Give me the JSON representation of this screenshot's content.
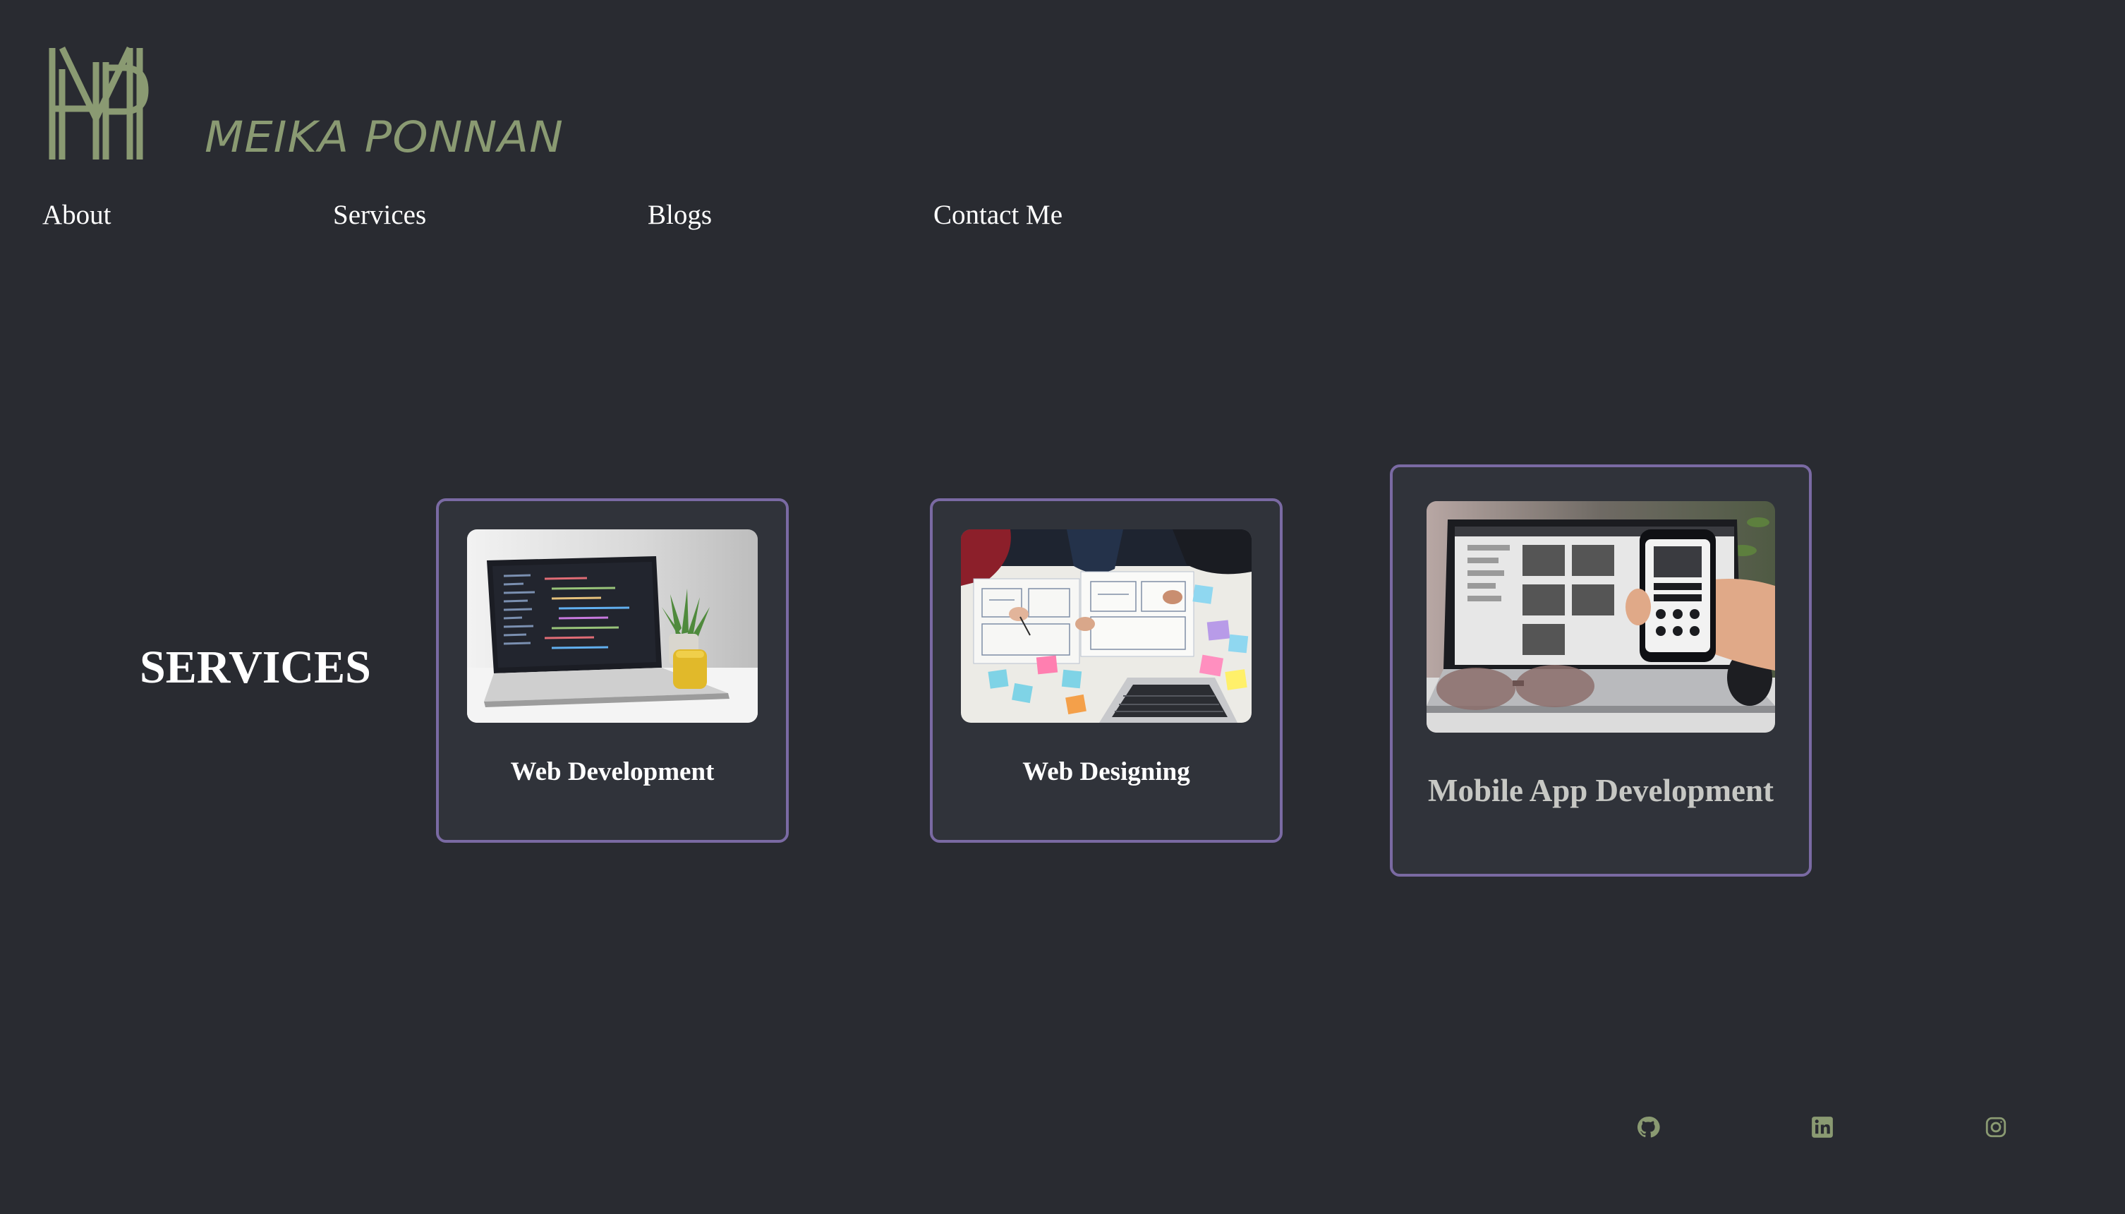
{
  "brand": {
    "name": "MEIKA PONNAN",
    "logo_icon": "mp-monogram-logo",
    "color": "#8a9a72"
  },
  "nav": {
    "items": [
      {
        "label": "About"
      },
      {
        "label": "Services"
      },
      {
        "label": "Blogs"
      },
      {
        "label": "Contact Me"
      }
    ]
  },
  "services": {
    "title": "SERVICES",
    "cards": [
      {
        "label": "Web Development",
        "image": "laptop-code-photo"
      },
      {
        "label": "Web Designing",
        "image": "wireframe-sketching-photo"
      },
      {
        "label": "Mobile App Development",
        "image": "phone-laptop-photo"
      }
    ],
    "card_border_color": "#7a6aa3"
  },
  "footer": {
    "social": [
      {
        "icon": "github-icon"
      },
      {
        "icon": "linkedin-icon"
      },
      {
        "icon": "instagram-icon"
      }
    ],
    "icon_color": "#8a9a72"
  },
  "colors": {
    "background": "#292b31",
    "card_background": "#30333a"
  }
}
